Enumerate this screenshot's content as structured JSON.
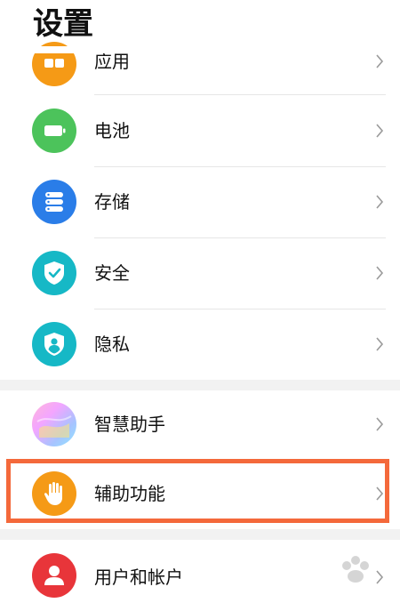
{
  "header": {
    "title": "设置"
  },
  "group1": {
    "items": [
      {
        "label": "应用",
        "icon": "apps-icon",
        "color": "#f59a16"
      },
      {
        "label": "电池",
        "icon": "battery-icon",
        "color": "#4cc35b"
      },
      {
        "label": "存储",
        "icon": "storage-icon",
        "color": "#2a7de8"
      },
      {
        "label": "安全",
        "icon": "shield-check-icon",
        "color": "#16b8c6"
      },
      {
        "label": "隐私",
        "icon": "privacy-shield-icon",
        "color": "#16b8c6"
      }
    ]
  },
  "group2": {
    "items": [
      {
        "label": "智慧助手",
        "icon": "smart-assistant-icon",
        "color": "#c88ee8"
      },
      {
        "label": "辅助功能",
        "icon": "hand-icon",
        "color": "#f59a16"
      }
    ]
  },
  "group3": {
    "items": [
      {
        "label": "用户和帐户",
        "icon": "user-icon",
        "color": "#e8353a"
      }
    ]
  },
  "accent_colors": {
    "highlight_border": "#f4693b",
    "section_gap": "#f2f2f2"
  }
}
